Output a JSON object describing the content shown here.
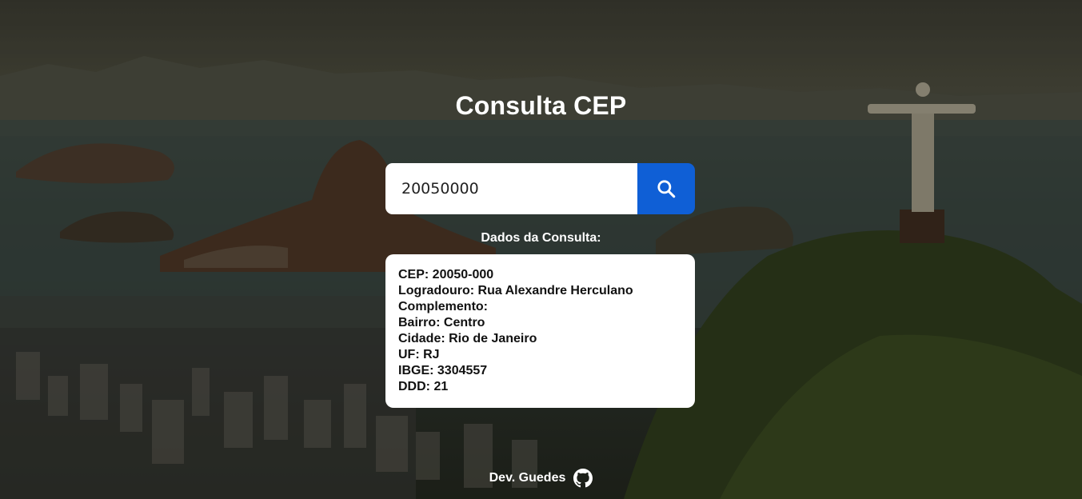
{
  "header": {
    "title": "Consulta CEP"
  },
  "search": {
    "value": "20050000"
  },
  "results": {
    "heading": "Dados da Consulta:",
    "lines": [
      "CEP: 20050-000",
      "Logradouro: Rua Alexandre Herculano",
      "Complemento:",
      "Bairro: Centro",
      "Cidade: Rio de Janeiro",
      "UF: RJ",
      "IBGE: 3304557",
      "DDD: 21"
    ]
  },
  "footer": {
    "author": "Dev. Guedes",
    "icon": "github-icon"
  },
  "colors": {
    "accent": "#0f5fd6",
    "card": "#ffffff",
    "text": "#ffffff"
  }
}
